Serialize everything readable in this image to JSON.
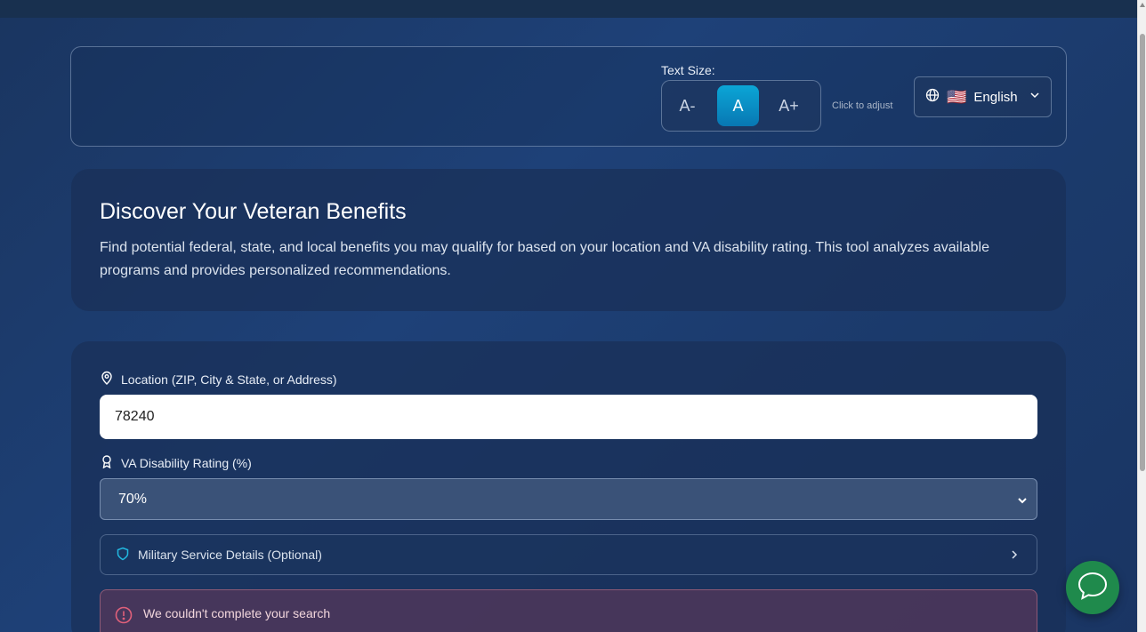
{
  "toolbar": {
    "text_size_label": "Text Size:",
    "decrease_label": "A-",
    "default_label": "A",
    "increase_label": "A+",
    "hint": "Click to adjust",
    "language": {
      "flag": "🇺🇸",
      "label": "English"
    }
  },
  "hero": {
    "title": "Discover Your Veteran Benefits",
    "description": "Find potential federal, state, and local benefits you may qualify for based on your location and VA disability rating. This tool analyzes available programs and provides personalized recommendations."
  },
  "form": {
    "location_label": "Location (ZIP, City & State, or Address)",
    "location_value": "78240",
    "rating_label": "VA Disability Rating (%)",
    "rating_value": "70%",
    "military_label": "Military Service Details (Optional)",
    "error_text": "We couldn't complete your search"
  },
  "colors": {
    "accent": "#0ba6d6",
    "chat": "#1f8a4c",
    "error": "#e0607a"
  }
}
